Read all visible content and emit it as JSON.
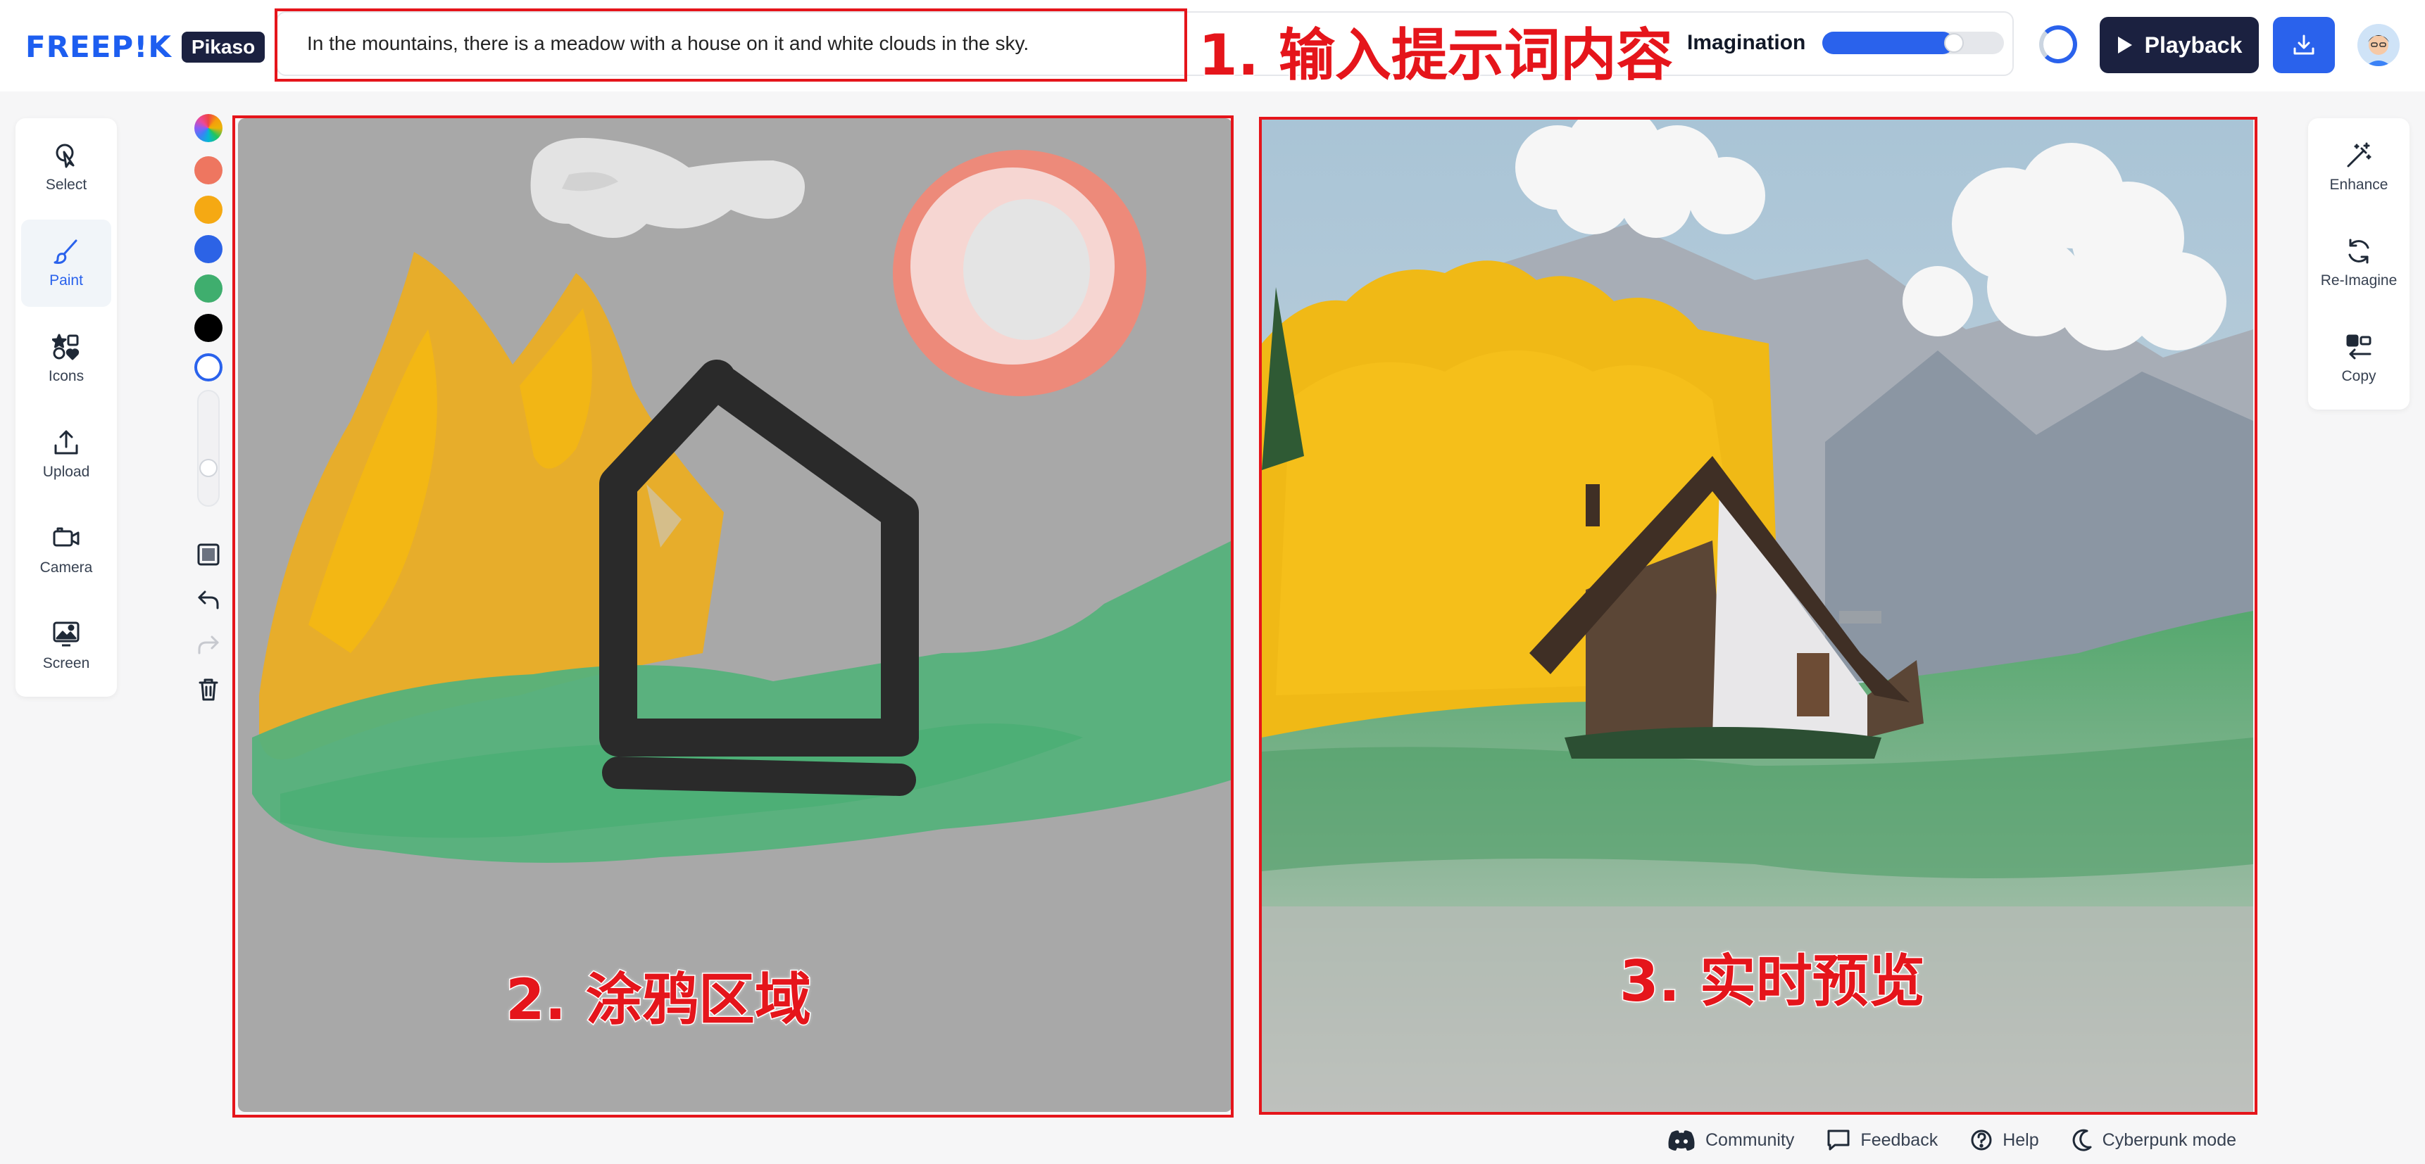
{
  "header": {
    "logo_text": "FREEP!K",
    "logo_badge": "Pikaso",
    "prompt_value": "In the mountains, there is a meadow with a house on it and white clouds in the sky.",
    "imagination_label": "Imagination",
    "imagination_level": 0.75,
    "playback_label": "Playback",
    "icons": {
      "play": "play-icon",
      "download": "download-icon",
      "spinner": "loading-spinner-icon",
      "avatar": "user-avatar"
    }
  },
  "annotations": {
    "prompt": "1. 输入提示词内容",
    "drawing_area": "2. 涂鸦区域",
    "preview": "3. 实时预览",
    "color": "#e5151b"
  },
  "left_toolbar": {
    "items": [
      {
        "label": "Select",
        "icon": "select-pointer-icon",
        "active": false
      },
      {
        "label": "Paint",
        "icon": "brush-icon",
        "active": true
      },
      {
        "label": "Icons",
        "icon": "shapes-icon",
        "active": false
      },
      {
        "label": "Upload",
        "icon": "upload-icon",
        "active": false
      },
      {
        "label": "Camera",
        "icon": "camera-icon",
        "active": false
      },
      {
        "label": "Screen",
        "icon": "screen-capture-icon",
        "active": false
      }
    ]
  },
  "palette": {
    "colors": [
      "#ee7660",
      "#f5a913",
      "#2c63e6",
      "#3fae6e",
      "#000000",
      "#ffffff"
    ],
    "selected": "#ffffff",
    "tools": [
      "background-fill-icon",
      "undo-icon",
      "redo-icon",
      "trash-icon"
    ]
  },
  "right_toolbar": {
    "items": [
      {
        "label": "Enhance",
        "icon": "magic-wand-icon"
      },
      {
        "label": "Re-Imagine",
        "icon": "refresh-icon"
      },
      {
        "label": "Copy",
        "icon": "copy-icon"
      }
    ]
  },
  "footer": {
    "links": [
      {
        "label": "Community",
        "icon": "discord-icon"
      },
      {
        "label": "Feedback",
        "icon": "chat-icon"
      },
      {
        "label": "Help",
        "icon": "help-circle-icon"
      },
      {
        "label": "Cyberpunk mode",
        "icon": "moon-icon"
      }
    ]
  }
}
